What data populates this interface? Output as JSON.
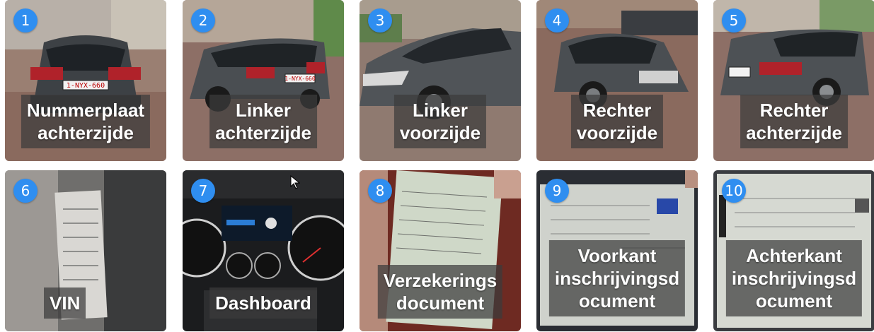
{
  "tiles": [
    {
      "number": "1",
      "lines": [
        "Nummerplaat",
        "achterzijde"
      ],
      "photo": "car-rear-plate",
      "plate": "1-NYX-660"
    },
    {
      "number": "2",
      "lines": [
        "Linker",
        "achterzijde"
      ],
      "photo": "car-rear-left",
      "plate": "1-NYX-660"
    },
    {
      "number": "3",
      "lines": [
        "Linker",
        "voorzijde"
      ],
      "photo": "car-front-left"
    },
    {
      "number": "4",
      "lines": [
        "Rechter",
        "voorzijde"
      ],
      "photo": "car-front-right"
    },
    {
      "number": "5",
      "lines": [
        "Rechter",
        "achterzijde"
      ],
      "photo": "car-rear-right"
    },
    {
      "number": "6",
      "lines": [
        "VIN"
      ],
      "photo": "vin-sticker"
    },
    {
      "number": "7",
      "lines": [
        "Dashboard"
      ],
      "photo": "dashboard"
    },
    {
      "number": "8",
      "lines": [
        "Verzekerings",
        "document"
      ],
      "photo": "insurance-document"
    },
    {
      "number": "9",
      "lines": [
        "Voorkant",
        "inschrijvingsd",
        "ocument"
      ],
      "photo": "registration-front"
    },
    {
      "number": "10",
      "lines": [
        "Achterkant",
        "inschrijvingsd",
        "ocument"
      ],
      "photo": "registration-back"
    }
  ],
  "colors": {
    "badge": "#2f8ef0",
    "label_bg": "rgba(60,60,60,0.72)"
  }
}
